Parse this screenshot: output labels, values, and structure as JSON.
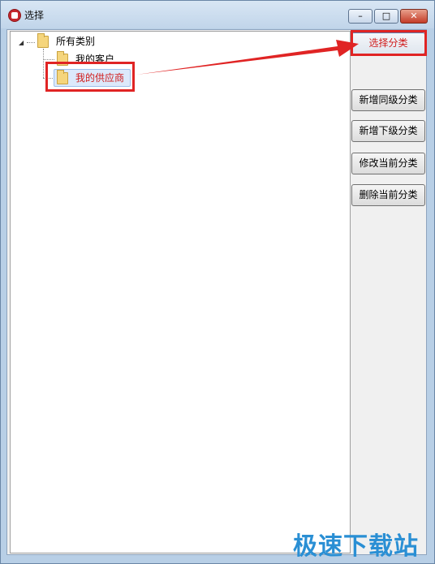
{
  "window": {
    "title": "选择"
  },
  "title_controls": {
    "minimize": "–",
    "maximize": "□",
    "close": "✕"
  },
  "tree": {
    "root": {
      "label": "所有类别",
      "expander": "◢"
    },
    "children": [
      {
        "label": "我的客户"
      },
      {
        "label": "我的供应商"
      }
    ]
  },
  "buttons": {
    "select": "选择分类",
    "add_sibling": "新增同级分类",
    "add_child": "新增下级分类",
    "edit": "修改当前分类",
    "delete": "删除当前分类"
  },
  "watermark": {
    "text": "极速下载站"
  },
  "colors": {
    "highlight": "#e02424",
    "watermark": "#2a8fd4"
  }
}
